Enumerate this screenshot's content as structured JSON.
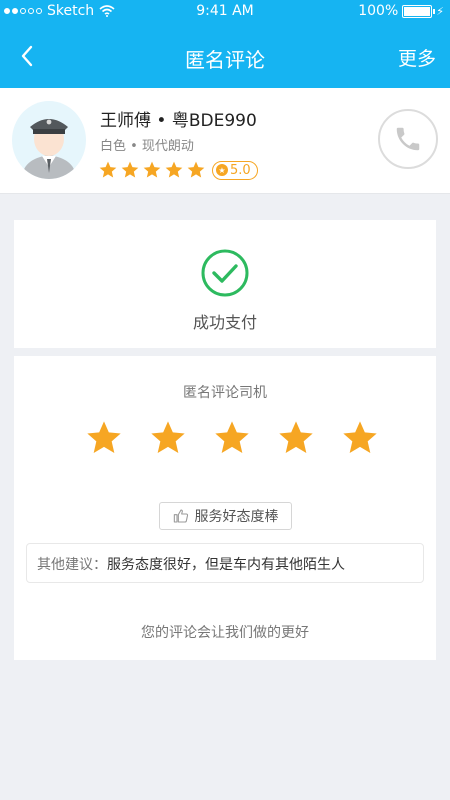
{
  "status": {
    "carrier": "Sketch",
    "time": "9:41 AM",
    "battery": "100%"
  },
  "nav": {
    "title": "匿名评论",
    "more": "更多"
  },
  "driver": {
    "name": "王师傅 • 粤BDE990",
    "car": "白色 • 现代朗动",
    "rating": "5.0",
    "star_count": 5
  },
  "payment": {
    "status": "成功支付",
    "accent_color": "#2dba5f"
  },
  "rating_section": {
    "title": "匿名评论司机",
    "stars_selected": 5,
    "stars_total": 5,
    "tag": "服务好态度棒",
    "suggestion_label": "其他建议：",
    "suggestion_text": "服务态度很好，但是车内有其他陌生人",
    "footer": "您的评论会让我们做的更好"
  },
  "colors": {
    "header": "#16b4f2",
    "star": "#f6a623"
  }
}
